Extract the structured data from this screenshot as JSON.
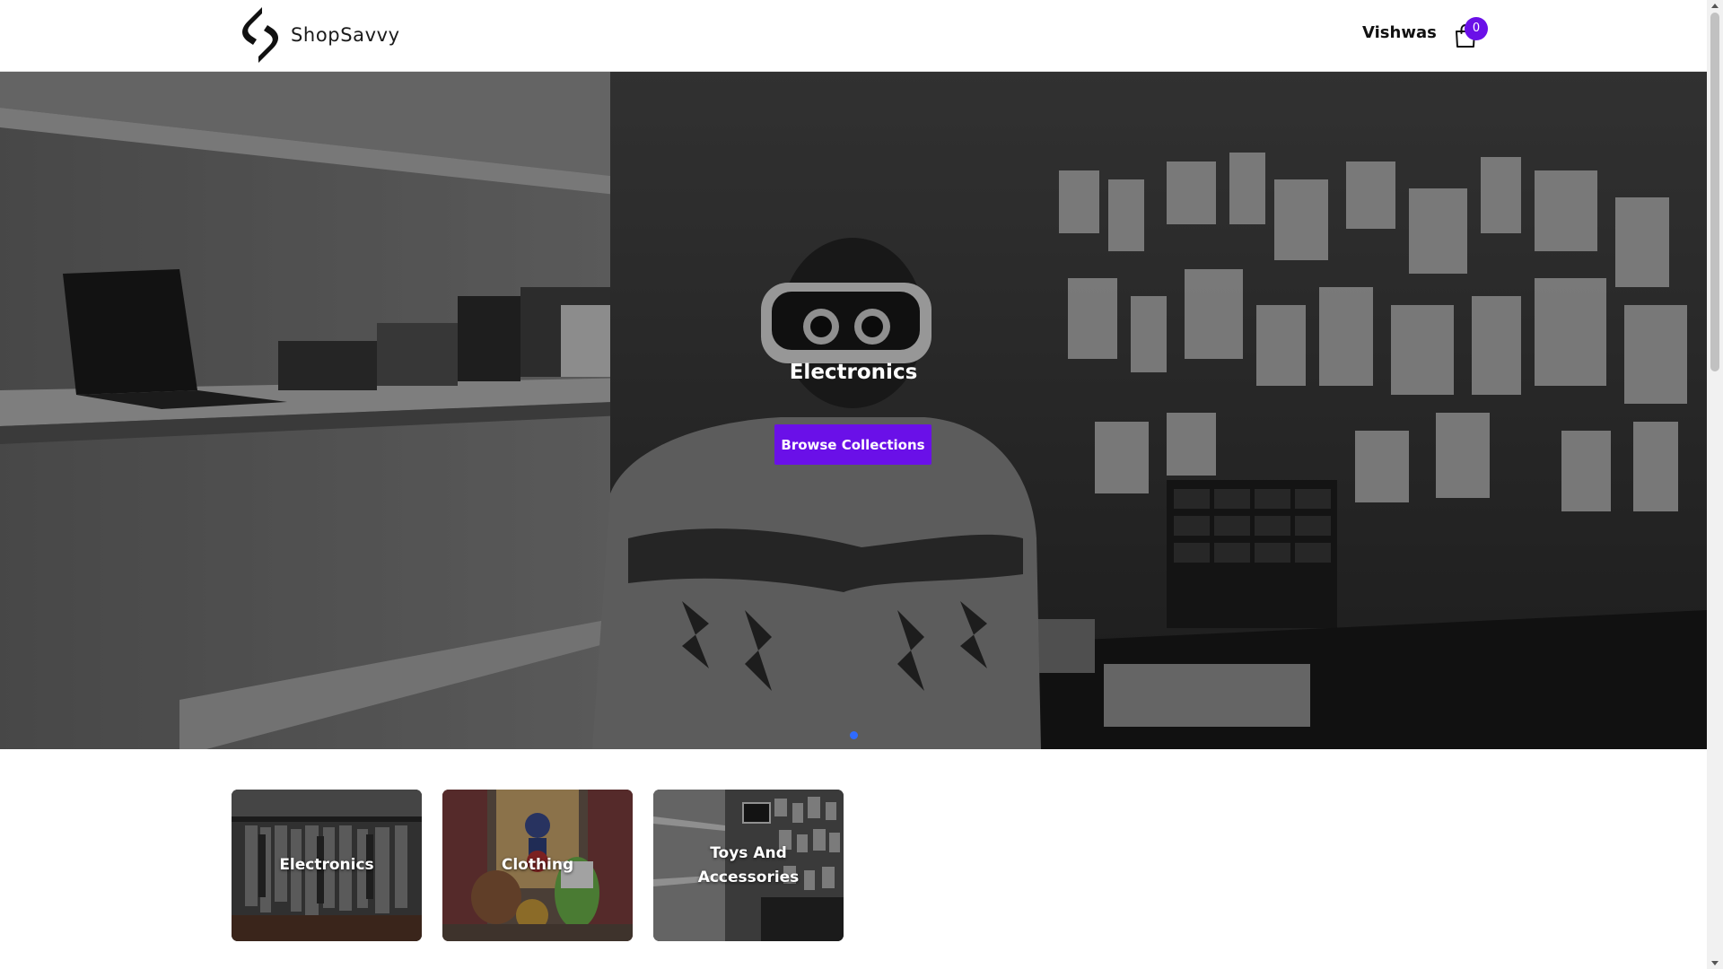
{
  "header": {
    "brand": "ShopSavvy",
    "user_name": "Vishwas",
    "cart_count": "0",
    "cart_icon": "shopping-bag-icon",
    "logo_icon": "shopsavvy-logo-mark"
  },
  "hero": {
    "title": "Electronics",
    "button_label": "Browse Collections",
    "active_slide": 1,
    "slide_count": 1
  },
  "categories": [
    {
      "label": "Electronics"
    },
    {
      "label": "Clothing"
    },
    {
      "label": "Toys And Accessories"
    }
  ],
  "colors": {
    "accent": "#6a10e8",
    "carousel_dot": "#2f6bff"
  }
}
